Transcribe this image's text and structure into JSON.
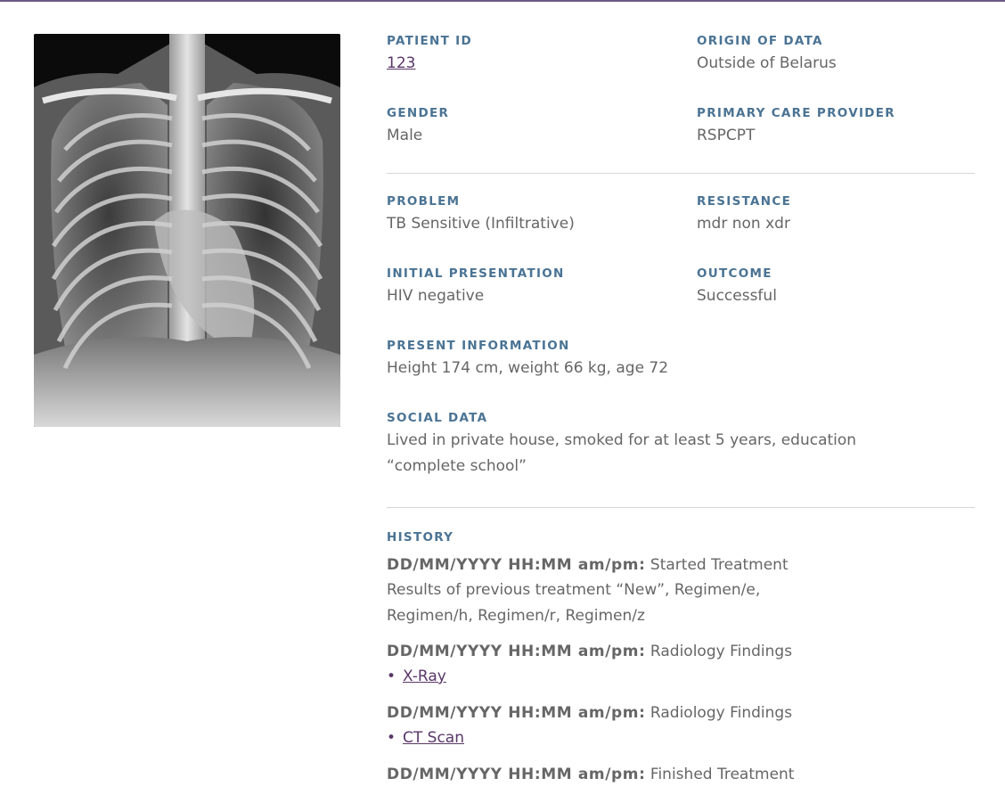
{
  "image": {
    "alt": "chest-xray"
  },
  "fields": {
    "patient_id": {
      "label": "PATIENT ID",
      "value": "123"
    },
    "origin": {
      "label": "ORIGIN OF DATA",
      "value": "Outside of Belarus"
    },
    "gender": {
      "label": "GENDER",
      "value": "Male"
    },
    "pcp": {
      "label": "PRIMARY CARE PROVIDER",
      "value": "RSPCPT"
    },
    "problem": {
      "label": "PROBLEM",
      "value": "TB Sensitive (Infiltrative)"
    },
    "resistance": {
      "label": "RESISTANCE",
      "value": "mdr non xdr"
    },
    "initial": {
      "label": "INITIAL PRESENTATION",
      "value": "HIV negative"
    },
    "outcome": {
      "label": "OUTCOME",
      "value": "Successful"
    },
    "present": {
      "label": "PRESENT INFORMATION",
      "value": "Height 174 cm, weight 66 kg, age 72"
    },
    "social": {
      "label": "SOCIAL DATA",
      "value_line1": "Lived in private house, smoked for at least 5 years, education",
      "value_line2": "“complete school”"
    }
  },
  "history": {
    "label": "HISTORY",
    "entries": [
      {
        "stamp": "DD/MM/YYYY HH:MM am/pm:",
        "event": "Started Treatment",
        "detail1": "Results of previous treatment “New”, Regimen/e,",
        "detail2": "Regimen/h, Regimen/r, Regimen/z"
      },
      {
        "stamp": "DD/MM/YYYY HH:MM am/pm:",
        "event": "Radiology Findings",
        "link": "X-Ray"
      },
      {
        "stamp": "DD/MM/YYYY HH:MM am/pm:",
        "event": "Radiology Findings",
        "link": "CT Scan"
      },
      {
        "stamp": "DD/MM/YYYY HH:MM am/pm:",
        "event": "Finished Treatment"
      }
    ]
  },
  "colors": {
    "label": "#4a7394",
    "text": "#666666",
    "link": "#5a3768",
    "divider": "#d6d6d6",
    "topline": "#6e5a86"
  }
}
